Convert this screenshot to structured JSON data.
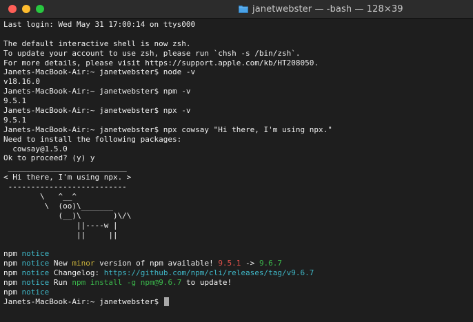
{
  "window": {
    "title": "janetwebster — -bash — 128×39",
    "colors": {
      "close": "#ff5f57",
      "minimize": "#febc2e",
      "maximize": "#28c840",
      "folder_icon": "#4aa3e8"
    },
    "icon": "folder-icon"
  },
  "terminal": {
    "lines": {
      "l0": "Last login: Wed May 31 17:00:14 on ttys000",
      "l1": "",
      "l2": "The default interactive shell is now zsh.",
      "l3": "To update your account to use zsh, please run `chsh -s /bin/zsh`.",
      "l4": "For more details, please visit https://support.apple.com/kb/HT208050.",
      "l5": "Janets-MacBook-Air:~ janetwebster$ node -v",
      "l6": "v18.16.0",
      "l7": "Janets-MacBook-Air:~ janetwebster$ npm -v",
      "l8": "9.5.1",
      "l9": "Janets-MacBook-Air:~ janetwebster$ npx -v",
      "l10": "9.5.1",
      "l11": "Janets-MacBook-Air:~ janetwebster$ npx cowsay \"Hi there, I'm using npx.\"",
      "l12": "Need to install the following packages:",
      "l13": "  cowsay@1.5.0",
      "l14": "Ok to proceed? (y) y",
      "l15": " __________________________",
      "l16": "< Hi there, I'm using npx. >",
      "l17": " --------------------------",
      "l18": "        \\   ^__^",
      "l19": "         \\  (oo)\\_______",
      "l20": "            (__)\\       )\\/\\",
      "l21": "                ||----w |",
      "l22": "                ||     ||",
      "l23": ""
    },
    "notices": {
      "prefix": "npm",
      "notice_word": "notice",
      "n1_a": "New ",
      "n1_minor": "minor",
      "n1_b": " version of npm available! ",
      "n1_old": "9.5.1",
      "n1_arrow": " -> ",
      "n1_new": "9.6.7",
      "n2_a": "Changelog: ",
      "n2_link": "https://github.com/npm/cli/releases/tag/v9.6.7",
      "n3_a": "Run ",
      "n3_cmd": "npm install -g npm@9.6.7",
      "n3_b": " to update!"
    },
    "prompt": "Janets-MacBook-Air:~ janetwebster$ "
  }
}
